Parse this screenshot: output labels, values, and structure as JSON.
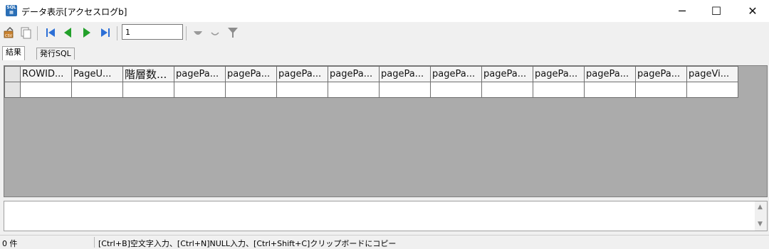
{
  "window": {
    "title": "データ表示[アクセスログb]",
    "minimize": "─",
    "maximize": "☐",
    "close": "✕"
  },
  "toolbar": {
    "record_value": "1"
  },
  "tabs": [
    {
      "label": "結果"
    },
    {
      "label": "発行SQL"
    }
  ],
  "grid": {
    "columns": [
      "ROWID...",
      "PageU...",
      "階層数...",
      "pagePa...",
      "pagePa...",
      "pagePa...",
      "pagePa...",
      "pagePa...",
      "pagePa...",
      "pagePa...",
      "pagePa...",
      "pagePa...",
      "pagePa...",
      "pageVi..."
    ],
    "rows": [
      [
        "",
        "",
        "",
        "",
        "",
        "",
        "",
        "",
        "",
        "",
        "",
        "",
        "",
        ""
      ]
    ]
  },
  "memo": {
    "value": ""
  },
  "status": {
    "count": "0 件",
    "hint": "[Ctrl+B]空文字入力、[Ctrl+N]NULL入力、[Ctrl+Shift+C]クリップボードにコピー"
  },
  "colors": {
    "grid_background": "#ababab",
    "nav_blue": "#2c6fd6",
    "nav_green": "#22a02a"
  }
}
